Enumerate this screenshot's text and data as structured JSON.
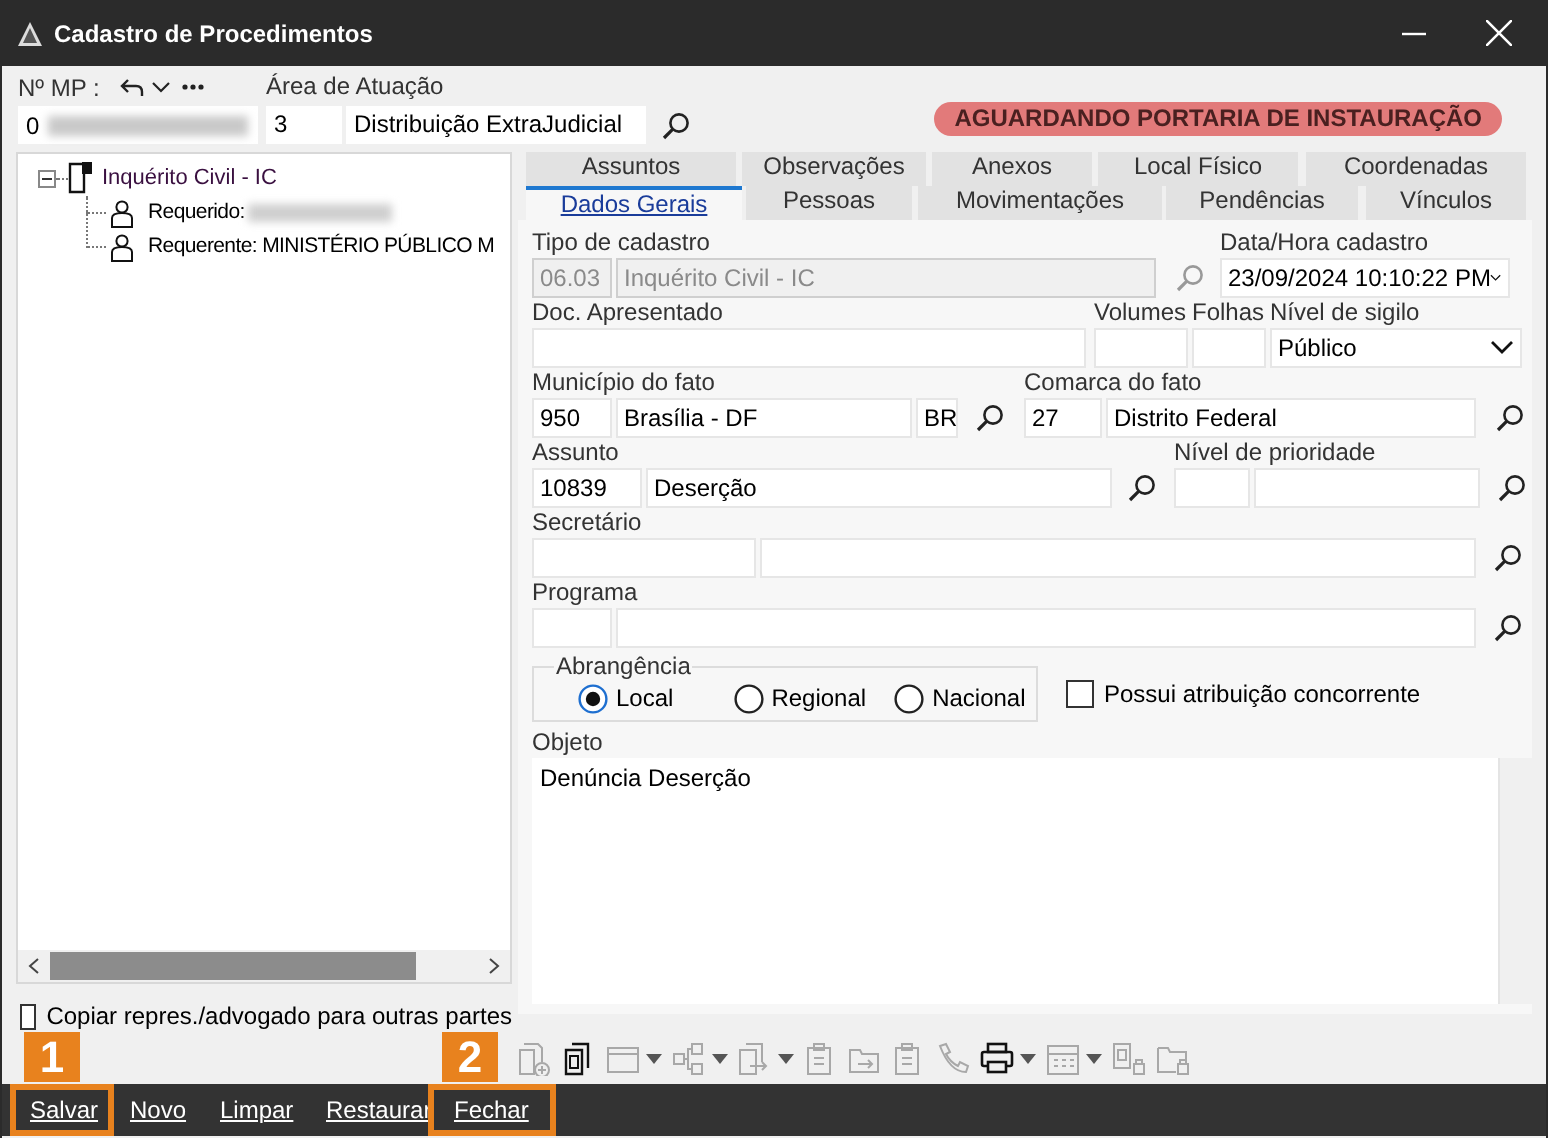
{
  "window": {
    "title": "Cadastro de Procedimentos"
  },
  "header": {
    "mp_label": "Nº MP :",
    "mp_value": "0",
    "area_label": "Área de Atuação",
    "area_code": "3",
    "area_value": "Distribuição ExtraJudicial",
    "status_badge": "AGUARDANDO PORTARIA DE INSTAURAÇÃO"
  },
  "tree": {
    "label": "Inquérito Civil - IC",
    "expanded": true,
    "children": [
      {
        "label": "Requerido:",
        "redacted": true
      },
      {
        "label": "Requerente: MINISTÉRIO PÚBLICO M",
        "redacted": false
      }
    ]
  },
  "copy_checkbox": {
    "label": "Copiar repres./advogado para outras partes",
    "checked": false
  },
  "tab_rows": [
    [
      {
        "label": "Assuntos",
        "selected": false
      },
      {
        "label": "Observações",
        "selected": false
      },
      {
        "label": "Anexos",
        "selected": false
      },
      {
        "label": "Local Físico",
        "selected": false
      },
      {
        "label": "Coordenadas",
        "selected": false
      }
    ],
    [
      {
        "label": "Dados Gerais",
        "selected": true
      },
      {
        "label": "Pessoas",
        "selected": false
      },
      {
        "label": "Movimentações",
        "selected": false
      },
      {
        "label": "Pendências",
        "selected": false
      },
      {
        "label": "Vínculos",
        "selected": false
      }
    ]
  ],
  "form_rows": [
    {
      "groups": [
        {
          "label": "Tipo de cadastro",
          "kind": "text",
          "disabled": true,
          "search": true,
          "fields": [
            {
              "value": "06.03"
            },
            {
              "value": "Inquérito Civil - IC"
            }
          ]
        },
        {
          "label": "Data/Hora cadastro",
          "kind": "dropdown",
          "disabled": false,
          "search": false,
          "fields": [
            {
              "value": "23/09/2024 10:10:22 PM"
            }
          ]
        }
      ]
    },
    {
      "groups": [
        {
          "label": "Doc. Apresentado",
          "kind": "text",
          "disabled": false,
          "search": false
        },
        {
          "label": "Volumes",
          "kind": "text",
          "disabled": false,
          "search": false
        },
        {
          "label": "Folhas",
          "kind": "text",
          "disabled": false,
          "search": false
        },
        {
          "label": "Nível de sigilo",
          "kind": "dropdown",
          "disabled": false,
          "search": false,
          "fields": [
            {
              "value": "Público"
            }
          ]
        }
      ]
    },
    {
      "groups": [
        {
          "label": "Município do fato",
          "kind": "text",
          "disabled": false,
          "search": true,
          "fields": [
            {
              "value": "950"
            },
            {
              "value": "Brasília - DF"
            },
            {
              "value": "BR"
            }
          ]
        },
        {
          "label": "Comarca do fato",
          "kind": "text",
          "disabled": false,
          "search": true,
          "fields": [
            {
              "value": "27"
            },
            {
              "value": "Distrito Federal"
            }
          ]
        }
      ]
    },
    {
      "groups": [
        {
          "label": "Assunto",
          "kind": "text",
          "disabled": false,
          "search": true,
          "fields": [
            {
              "value": "10839"
            },
            {
              "value": "Deserção"
            }
          ]
        },
        {
          "label": "Nível de prioridade",
          "kind": "text",
          "disabled": false,
          "search": true
        }
      ]
    },
    {
      "groups": [
        {
          "label": "Secretário",
          "kind": "text",
          "disabled": false,
          "search": true
        }
      ]
    },
    {
      "groups": [
        {
          "label": "Programa",
          "kind": "text",
          "disabled": false,
          "search": true
        }
      ]
    }
  ],
  "abrangencia": {
    "label": "Abrangência",
    "options": [
      {
        "label": "Local",
        "selected": true
      },
      {
        "label": "Regional",
        "selected": false
      },
      {
        "label": "Nacional",
        "selected": false
      }
    ]
  },
  "concorrente_checkbox": {
    "label": "Possui atribuição concorrente",
    "checked": false
  },
  "objeto": {
    "label": "Objeto",
    "value": "Denúncia Deserção"
  },
  "toolbar": [
    {
      "disabled": true,
      "dropdown": false
    },
    {
      "disabled": false,
      "dropdown": false
    },
    {
      "disabled": true,
      "dropdown": true
    },
    {
      "disabled": true,
      "dropdown": true
    },
    {
      "disabled": true,
      "dropdown": true
    },
    {
      "disabled": true,
      "dropdown": false
    },
    {
      "disabled": true,
      "dropdown": false
    },
    {
      "disabled": true,
      "dropdown": false
    },
    {
      "disabled": true,
      "dropdown": false
    },
    {
      "disabled": false,
      "dropdown": true
    },
    {
      "disabled": true,
      "dropdown": true
    },
    {
      "disabled": true,
      "dropdown": false
    },
    {
      "disabled": true,
      "dropdown": false
    }
  ],
  "actions": [
    {
      "label": "Salvar",
      "callout": "1"
    },
    {
      "label": "Novo"
    },
    {
      "label": "Limpar"
    },
    {
      "label": "Restaurar"
    },
    {
      "label": "Fechar",
      "callout": "2"
    }
  ]
}
